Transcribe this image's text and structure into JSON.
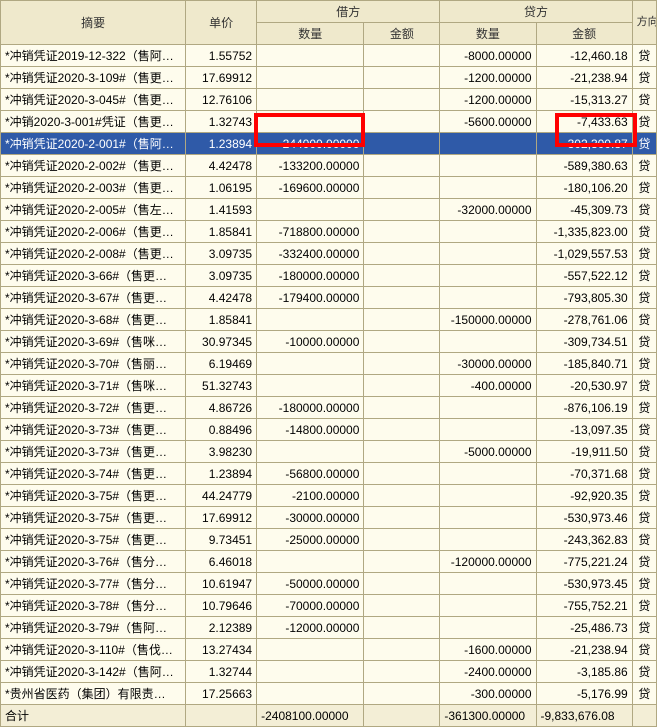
{
  "headers": {
    "summary": "摘要",
    "price": "单价",
    "debit": "借方",
    "credit": "贷方",
    "dir": "方向",
    "qty": "数量",
    "amt": "金额"
  },
  "total_label": "合计",
  "rows": [
    {
      "s": "*冲销凭证2019-12-322（售阿…",
      "p": "1.55752",
      "dq": "",
      "da": "",
      "cq": "-8000.00000",
      "ca": "-12,460.18",
      "d": "贷"
    },
    {
      "s": "*冲销凭证2020-3-109#（售更…",
      "p": "17.69912",
      "dq": "",
      "da": "",
      "cq": "-1200.00000",
      "ca": "-21,238.94",
      "d": "贷"
    },
    {
      "s": "*冲销凭证2020-3-045#（售更…",
      "p": "12.76106",
      "dq": "",
      "da": "",
      "cq": "-1200.00000",
      "ca": "-15,313.27",
      "d": "贷"
    },
    {
      "s": "*冲销2020-3-001#凭证（售更…",
      "p": "1.32743",
      "dq": "",
      "da": "",
      "cq": "-5600.00000",
      "ca": "-7,433.63",
      "d": "贷"
    },
    {
      "s": "*冲销凭证2020-2-001#（售阿…",
      "p": "1.23894",
      "dq": "-244000.00000",
      "da": "",
      "cq": "",
      "ca": "-302,300.87",
      "d": "贷",
      "sel": true
    },
    {
      "s": "*冲销凭证2020-2-002#（售更…",
      "p": "4.42478",
      "dq": "-133200.00000",
      "da": "",
      "cq": "",
      "ca": "-589,380.63",
      "d": "贷"
    },
    {
      "s": "*冲销凭证2020-2-003#（售更…",
      "p": "1.06195",
      "dq": "-169600.00000",
      "da": "",
      "cq": "",
      "ca": "-180,106.20",
      "d": "贷"
    },
    {
      "s": "*冲销凭证2020-2-005#（售左…",
      "p": "1.41593",
      "dq": "",
      "da": "",
      "cq": "-32000.00000",
      "ca": "-45,309.73",
      "d": "贷"
    },
    {
      "s": "*冲销凭证2020-2-006#（售更…",
      "p": "1.85841",
      "dq": "-718800.00000",
      "da": "",
      "cq": "",
      "ca": "-1,335,823.00",
      "d": "贷"
    },
    {
      "s": "*冲销凭证2020-2-008#（售更…",
      "p": "3.09735",
      "dq": "-332400.00000",
      "da": "",
      "cq": "",
      "ca": "-1,029,557.53",
      "d": "贷"
    },
    {
      "s": "*冲销凭证2020-3-66#（售更…",
      "p": "3.09735",
      "dq": "-180000.00000",
      "da": "",
      "cq": "",
      "ca": "-557,522.12",
      "d": "贷"
    },
    {
      "s": "*冲销凭证2020-3-67#（售更…",
      "p": "4.42478",
      "dq": "-179400.00000",
      "da": "",
      "cq": "",
      "ca": "-793,805.30",
      "d": "贷"
    },
    {
      "s": "*冲销凭证2020-3-68#（售更…",
      "p": "1.85841",
      "dq": "",
      "da": "",
      "cq": "-150000.00000",
      "ca": "-278,761.06",
      "d": "贷"
    },
    {
      "s": "*冲销凭证2020-3-69#（售咪…",
      "p": "30.97345",
      "dq": "-10000.00000",
      "da": "",
      "cq": "",
      "ca": "-309,734.51",
      "d": "贷"
    },
    {
      "s": "*冲销凭证2020-3-70#（售丽…",
      "p": "6.19469",
      "dq": "",
      "da": "",
      "cq": "-30000.00000",
      "ca": "-185,840.71",
      "d": "贷"
    },
    {
      "s": "*冲销凭证2020-3-71#（售咪…",
      "p": "51.32743",
      "dq": "",
      "da": "",
      "cq": "-400.00000",
      "ca": "-20,530.97",
      "d": "贷"
    },
    {
      "s": "*冲销凭证2020-3-72#（售更…",
      "p": "4.86726",
      "dq": "-180000.00000",
      "da": "",
      "cq": "",
      "ca": "-876,106.19",
      "d": "贷"
    },
    {
      "s": "*冲销凭证2020-3-73#（售更…",
      "p": "0.88496",
      "dq": "-14800.00000",
      "da": "",
      "cq": "",
      "ca": "-13,097.35",
      "d": "贷"
    },
    {
      "s": "*冲销凭证2020-3-73#（售更…",
      "p": "3.98230",
      "dq": "",
      "da": "",
      "cq": "-5000.00000",
      "ca": "-19,911.50",
      "d": "贷"
    },
    {
      "s": "*冲销凭证2020-3-74#（售更…",
      "p": "1.23894",
      "dq": "-56800.00000",
      "da": "",
      "cq": "",
      "ca": "-70,371.68",
      "d": "贷"
    },
    {
      "s": "*冲销凭证2020-3-75#（售更…",
      "p": "44.24779",
      "dq": "-2100.00000",
      "da": "",
      "cq": "",
      "ca": "-92,920.35",
      "d": "贷"
    },
    {
      "s": "*冲销凭证2020-3-75#（售更…",
      "p": "17.69912",
      "dq": "-30000.00000",
      "da": "",
      "cq": "",
      "ca": "-530,973.46",
      "d": "贷"
    },
    {
      "s": "*冲销凭证2020-3-75#（售更…",
      "p": "9.73451",
      "dq": "-25000.00000",
      "da": "",
      "cq": "",
      "ca": "-243,362.83",
      "d": "贷"
    },
    {
      "s": "*冲销凭证2020-3-76#（售分…",
      "p": "6.46018",
      "dq": "",
      "da": "",
      "cq": "-120000.00000",
      "ca": "-775,221.24",
      "d": "贷"
    },
    {
      "s": "*冲销凭证2020-3-77#（售分…",
      "p": "10.61947",
      "dq": "-50000.00000",
      "da": "",
      "cq": "",
      "ca": "-530,973.45",
      "d": "贷"
    },
    {
      "s": "*冲销凭证2020-3-78#（售分…",
      "p": "10.79646",
      "dq": "-70000.00000",
      "da": "",
      "cq": "",
      "ca": "-755,752.21",
      "d": "贷"
    },
    {
      "s": "*冲销凭证2020-3-79#（售阿…",
      "p": "2.12389",
      "dq": "-12000.00000",
      "da": "",
      "cq": "",
      "ca": "-25,486.73",
      "d": "贷"
    },
    {
      "s": "*冲销凭证2020-3-110#（售伐…",
      "p": "13.27434",
      "dq": "",
      "da": "",
      "cq": "-1600.00000",
      "ca": "-21,238.94",
      "d": "贷"
    },
    {
      "s": "*冲销凭证2020-3-142#（售阿…",
      "p": "1.32744",
      "dq": "",
      "da": "",
      "cq": "-2400.00000",
      "ca": "-3,185.86",
      "d": "贷"
    },
    {
      "s": "*贵州省医药（集团）有限责…",
      "p": "17.25663",
      "dq": "",
      "da": "",
      "cq": "-300.00000",
      "ca": "-5,176.99",
      "d": "贷"
    }
  ],
  "totals": {
    "dq": "-2408100.00000",
    "da": "",
    "cq": "-361300.00000",
    "ca": "-9,833,676.08"
  }
}
